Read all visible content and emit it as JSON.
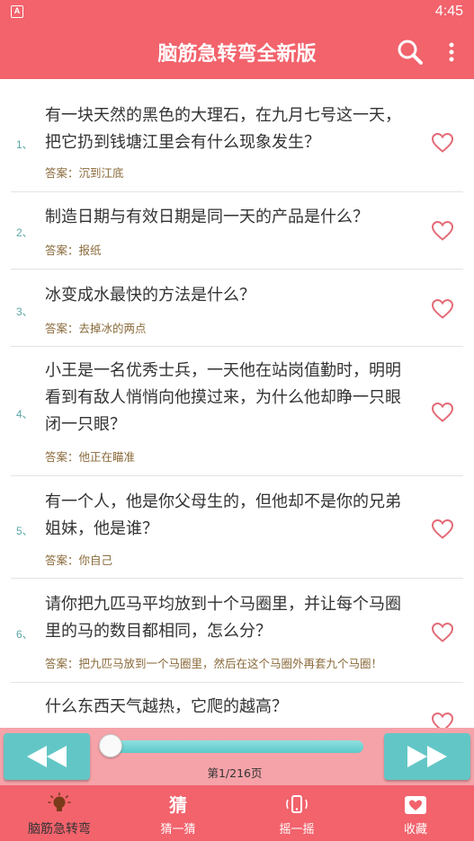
{
  "status": {
    "time": "4:45",
    "app_icon_letter": "A"
  },
  "header": {
    "title": "脑筋急转弯全新版"
  },
  "answer_label": "答案：",
  "items": [
    {
      "num": "1、",
      "question": "有一块天然的黑色的大理石，在九月七号这一天，把它扔到钱塘江里会有什么现象发生？",
      "answer": "沉到江底"
    },
    {
      "num": "2、",
      "question": "制造日期与有效日期是同一天的产品是什么？",
      "answer": "报纸"
    },
    {
      "num": "3、",
      "question": "冰变成水最快的方法是什么？",
      "answer": "去掉冰的两点"
    },
    {
      "num": "4、",
      "question": "小王是一名优秀士兵，一天他在站岗值勤时，明明看到有敌人悄悄向他摸过来，为什么他却睁一只眼闭一只眼？",
      "answer": "他正在瞄准"
    },
    {
      "num": "5、",
      "question": "有一个人，他是你父母生的，但他却不是你的兄弟姐妹，他是谁？",
      "answer": "你自己"
    },
    {
      "num": "6、",
      "question": "请你把九匹马平均放到十个马圈里，并让每个马圈里的马的数目都相同，怎么分？",
      "answer": "把九匹马放到一个马圈里，然后在这个马圈外再套九个马圈！"
    },
    {
      "num": "",
      "question": "什么东西天气越热，它爬的越高？",
      "answer": ""
    }
  ],
  "player": {
    "page": "第1/216页",
    "progress": 0.0
  },
  "tabs": [
    {
      "label": "脑筋急转弯",
      "icon": "lightbulb-icon"
    },
    {
      "label": "猜一猜",
      "icon": "guess-icon"
    },
    {
      "label": "摇一摇",
      "icon": "shake-icon"
    },
    {
      "label": "收藏",
      "icon": "favorite-icon"
    }
  ],
  "colors": {
    "primary": "#f2636c",
    "accent": "#63c6c6",
    "player_bg": "#f5a3a9"
  }
}
